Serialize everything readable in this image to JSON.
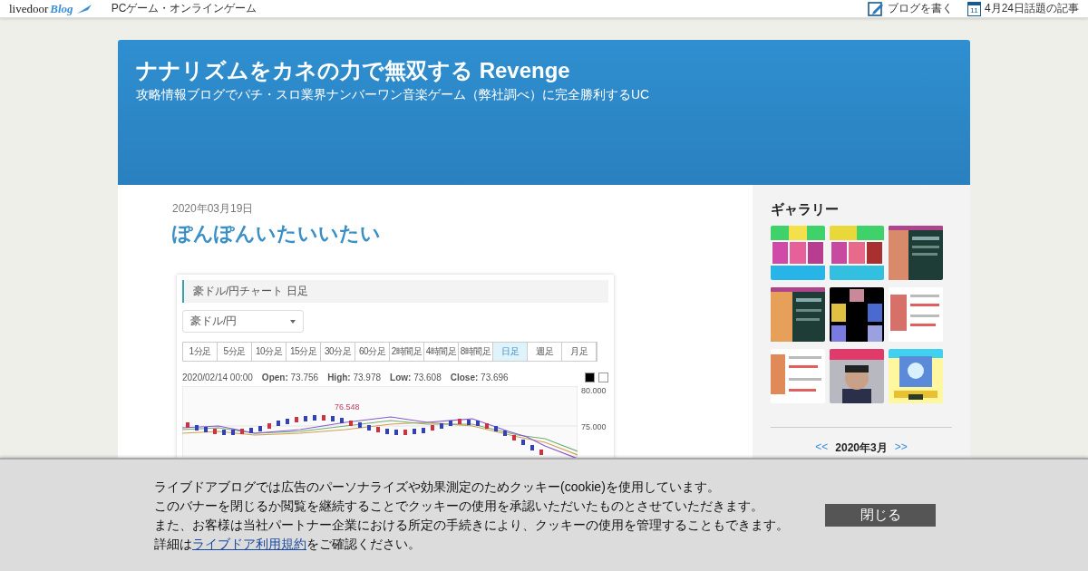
{
  "top_bar": {
    "logo": {
      "brand": "livedoor",
      "product": "Blog"
    },
    "category": "PCゲーム・オンラインゲーム",
    "links": [
      {
        "kind": "write",
        "label": "ブログを書く"
      },
      {
        "kind": "calendar",
        "icon_text": "11",
        "label": "4月24日話題の記事"
      }
    ]
  },
  "header": {
    "title": "ナナリズムをカネの力で無双する Revenge",
    "subtitle": "攻略情報ブログでパチ・スロ業界ナンバーワン音楽ゲーム（弊社調べ）に完全勝利するUC"
  },
  "post": {
    "date": "2020年03月19日",
    "title": "ぽんぽんいたいいたい",
    "screenshot": {
      "title": "豪ドル/円チャート 日足",
      "select": "豪ドル/円",
      "intervals": [
        {
          "label": "1分足",
          "selected": false
        },
        {
          "label": "5分足",
          "selected": false
        },
        {
          "label": "10分足",
          "selected": false
        },
        {
          "label": "15分足",
          "selected": false
        },
        {
          "label": "30分足",
          "selected": false
        },
        {
          "label": "60分足",
          "selected": false
        },
        {
          "label": "2時間足",
          "selected": false
        },
        {
          "label": "4時間足",
          "selected": false
        },
        {
          "label": "8時間足",
          "selected": false
        },
        {
          "label": "日足",
          "selected": true
        },
        {
          "label": "週足",
          "selected": false
        },
        {
          "label": "月足",
          "selected": false
        }
      ],
      "time": "2020/02/14 00:00",
      "fields": [
        {
          "label": "Open:",
          "value": "73.756"
        },
        {
          "label": "High:",
          "value": "73.978"
        },
        {
          "label": "Low:",
          "value": "73.608"
        },
        {
          "label": "Close:",
          "value": "73.696"
        }
      ],
      "peak_label": "76.548",
      "y_ticks": [
        "80.000",
        "75.000"
      ]
    }
  },
  "sidebar": {
    "gallery": {
      "heading": "ギャラリー"
    },
    "calendar": {
      "prev": "<<",
      "month": "2020年3月",
      "next": ">>"
    }
  },
  "cookie_banner": {
    "lines": [
      "ライブドアブログでは広告のパーソナライズや効果測定のためクッキー(cookie)を使用しています。",
      "このバナーを閉じるか閲覧を継続することでクッキーの使用を承認いただいたものとさせていただきます。",
      "また、お客様は当社パートナー企業における所定の手続きにより、クッキーの使用を管理することもできます。"
    ],
    "last_line": {
      "before": "詳細は",
      "link": "ライブドア利用規約",
      "after": "をご確認ください。"
    },
    "button": "閉じる"
  }
}
